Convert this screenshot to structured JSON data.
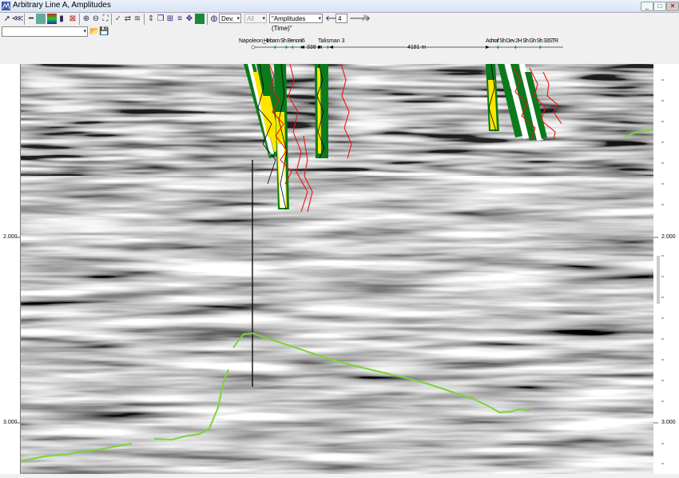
{
  "window": {
    "title": "Arbitrary Line A, Amplitudes",
    "min_glyph": "_",
    "max_glyph": "□",
    "close_glyph": "✕"
  },
  "toolbar": {
    "icons": [
      "pointer-icon",
      "multi-select-icon",
      "zoom-rect-icon",
      "overview-icon",
      "colorbar-icon",
      "swap-icon",
      "check-icon",
      "well-icon",
      "horizon-icon",
      "zoom-in-icon",
      "zoom-out-icon",
      "fit-icon",
      "tools-icon"
    ],
    "mode_select": "Dev.",
    "all_select": "All",
    "display_select": "\"Amplitudes (Time)\"",
    "step_value": "4"
  },
  "toolbar2": {
    "line_select": ""
  },
  "wells": {
    "napoleon": "Napoleon_1",
    "overlap_group": "Hebam Sh Benoni6",
    "talisman": "Talisman 3",
    "right_group": "Ashraf Sh Dev 2H Sh Gh Sh 33STR",
    "spacing1": "338 m",
    "spacing2": "4181 m"
  },
  "axis": {
    "left_ticks": [
      "2.000",
      "3.000"
    ],
    "right_ticks": [
      "2.000",
      "3.000"
    ]
  },
  "colors": {
    "horizon": "#7dd33a",
    "well_green": "#0b7a1c",
    "well_red": "#ee1111",
    "well_yellow": "#ffe600"
  }
}
